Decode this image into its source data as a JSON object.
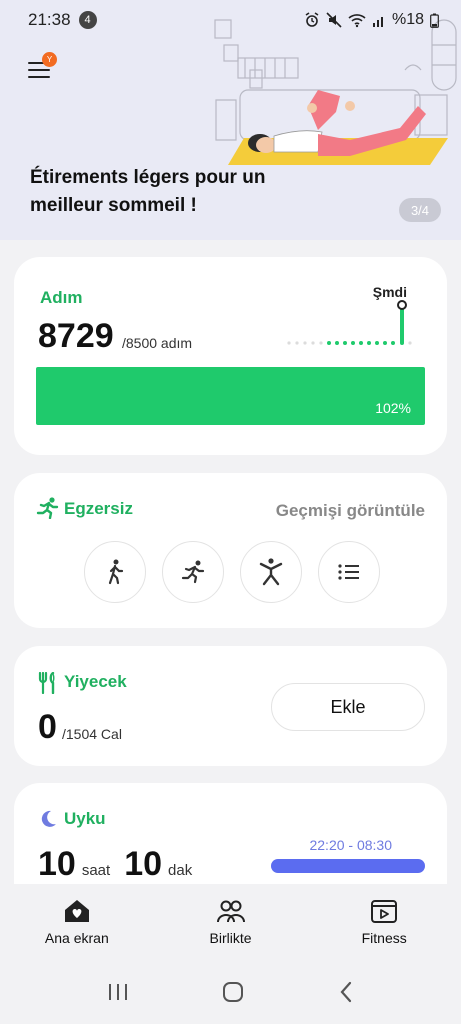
{
  "status_bar": {
    "time": "21:38",
    "notification_count": "4",
    "battery_text": "%18"
  },
  "banner": {
    "title": "Étirements légers pour un meilleur sommeil !",
    "page_indicator": "3/4",
    "menu_badge": "Y"
  },
  "steps": {
    "title": "Adım",
    "value": "8729",
    "goal_text": "/8500 adım",
    "now_label": "Şmdi",
    "progress_percent": 102,
    "progress_label": "102%"
  },
  "exercise": {
    "title": "Egzersiz",
    "history_link": "Geçmişi görüntüle",
    "buttons": [
      "walk-icon",
      "run-icon",
      "workout-icon",
      "list-icon"
    ]
  },
  "food": {
    "title": "Yiyecek",
    "value": "0",
    "goal_text": "/1504 Cal",
    "add_label": "Ekle"
  },
  "sleep": {
    "title": "Uyku",
    "hours": "10",
    "hours_unit": "saat",
    "minutes": "10",
    "minutes_unit": "dak",
    "time_range": "22:20 - 08:30"
  },
  "bottom_nav": {
    "items": [
      {
        "label": "Ana ekran",
        "icon": "home-heart-icon"
      },
      {
        "label": "Birlikte",
        "icon": "people-icon"
      },
      {
        "label": "Fitness",
        "icon": "video-play-icon"
      }
    ]
  },
  "colors": {
    "accent_green": "#1fca6c",
    "sleep_blue": "#5b6cf0",
    "banner_bg": "#e9eaf5"
  }
}
